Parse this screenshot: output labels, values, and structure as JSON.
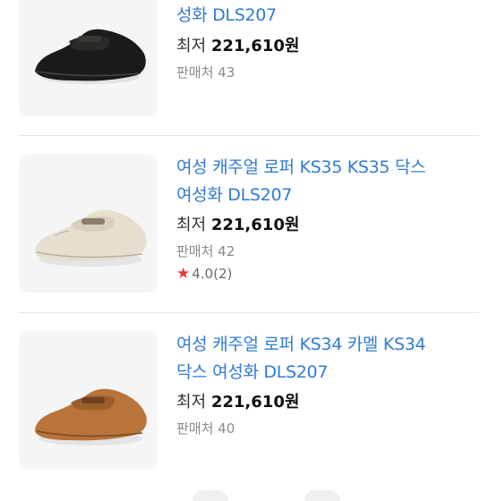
{
  "items": [
    {
      "title_lines": [
        "성화 DLS207"
      ],
      "price_label": "최저",
      "price_value": "221,610원",
      "sellers": "판매처 43",
      "shoe_color": "black"
    },
    {
      "title_lines": [
        "여성 캐주얼 로퍼 KS35 KS35 닥스",
        "여성화 DLS207"
      ],
      "price_label": "최저",
      "price_value": "221,610원",
      "sellers": "판매처 42",
      "rating": "4.0",
      "review_count": "(2)",
      "shoe_color": "beige"
    },
    {
      "title_lines": [
        "여성 캐주얼 로퍼 KS34 카멜 KS34",
        "닥스 여성화 DLS207"
      ],
      "price_label": "최저",
      "price_value": "221,610원",
      "sellers": "판매처 40",
      "shoe_color": "camel"
    }
  ],
  "colors": {
    "title": "#2f7bd6",
    "star": "#e53935",
    "black_shoe": "#1c1b1a",
    "beige_shoe": "#e6dfd0",
    "camel_shoe": "#b8743a"
  },
  "icons": [
    "star-icon"
  ]
}
